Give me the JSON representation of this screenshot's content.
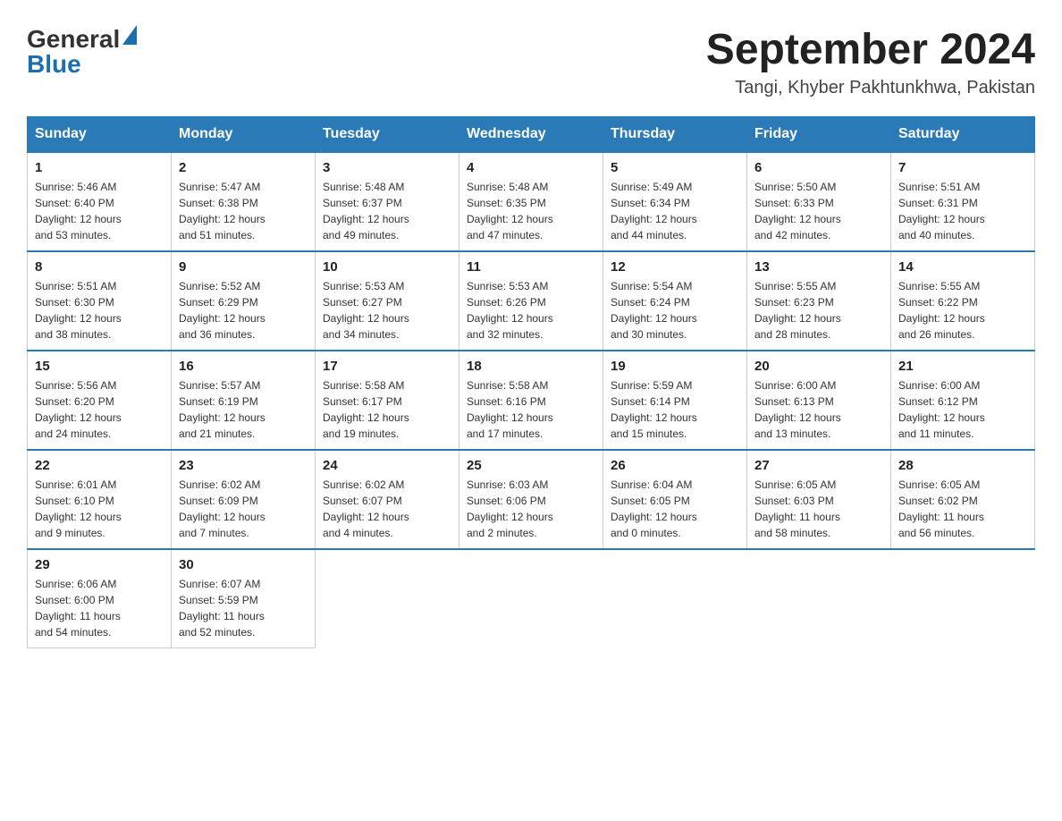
{
  "header": {
    "logo_general": "General",
    "logo_blue": "Blue",
    "month_year": "September 2024",
    "location": "Tangi, Khyber Pakhtunkhwa, Pakistan"
  },
  "weekdays": [
    "Sunday",
    "Monday",
    "Tuesday",
    "Wednesday",
    "Thursday",
    "Friday",
    "Saturday"
  ],
  "weeks": [
    [
      {
        "day": "1",
        "sunrise": "5:46 AM",
        "sunset": "6:40 PM",
        "daylight": "12 hours and 53 minutes."
      },
      {
        "day": "2",
        "sunrise": "5:47 AM",
        "sunset": "6:38 PM",
        "daylight": "12 hours and 51 minutes."
      },
      {
        "day": "3",
        "sunrise": "5:48 AM",
        "sunset": "6:37 PM",
        "daylight": "12 hours and 49 minutes."
      },
      {
        "day": "4",
        "sunrise": "5:48 AM",
        "sunset": "6:35 PM",
        "daylight": "12 hours and 47 minutes."
      },
      {
        "day": "5",
        "sunrise": "5:49 AM",
        "sunset": "6:34 PM",
        "daylight": "12 hours and 44 minutes."
      },
      {
        "day": "6",
        "sunrise": "5:50 AM",
        "sunset": "6:33 PM",
        "daylight": "12 hours and 42 minutes."
      },
      {
        "day": "7",
        "sunrise": "5:51 AM",
        "sunset": "6:31 PM",
        "daylight": "12 hours and 40 minutes."
      }
    ],
    [
      {
        "day": "8",
        "sunrise": "5:51 AM",
        "sunset": "6:30 PM",
        "daylight": "12 hours and 38 minutes."
      },
      {
        "day": "9",
        "sunrise": "5:52 AM",
        "sunset": "6:29 PM",
        "daylight": "12 hours and 36 minutes."
      },
      {
        "day": "10",
        "sunrise": "5:53 AM",
        "sunset": "6:27 PM",
        "daylight": "12 hours and 34 minutes."
      },
      {
        "day": "11",
        "sunrise": "5:53 AM",
        "sunset": "6:26 PM",
        "daylight": "12 hours and 32 minutes."
      },
      {
        "day": "12",
        "sunrise": "5:54 AM",
        "sunset": "6:24 PM",
        "daylight": "12 hours and 30 minutes."
      },
      {
        "day": "13",
        "sunrise": "5:55 AM",
        "sunset": "6:23 PM",
        "daylight": "12 hours and 28 minutes."
      },
      {
        "day": "14",
        "sunrise": "5:55 AM",
        "sunset": "6:22 PM",
        "daylight": "12 hours and 26 minutes."
      }
    ],
    [
      {
        "day": "15",
        "sunrise": "5:56 AM",
        "sunset": "6:20 PM",
        "daylight": "12 hours and 24 minutes."
      },
      {
        "day": "16",
        "sunrise": "5:57 AM",
        "sunset": "6:19 PM",
        "daylight": "12 hours and 21 minutes."
      },
      {
        "day": "17",
        "sunrise": "5:58 AM",
        "sunset": "6:17 PM",
        "daylight": "12 hours and 19 minutes."
      },
      {
        "day": "18",
        "sunrise": "5:58 AM",
        "sunset": "6:16 PM",
        "daylight": "12 hours and 17 minutes."
      },
      {
        "day": "19",
        "sunrise": "5:59 AM",
        "sunset": "6:14 PM",
        "daylight": "12 hours and 15 minutes."
      },
      {
        "day": "20",
        "sunrise": "6:00 AM",
        "sunset": "6:13 PM",
        "daylight": "12 hours and 13 minutes."
      },
      {
        "day": "21",
        "sunrise": "6:00 AM",
        "sunset": "6:12 PM",
        "daylight": "12 hours and 11 minutes."
      }
    ],
    [
      {
        "day": "22",
        "sunrise": "6:01 AM",
        "sunset": "6:10 PM",
        "daylight": "12 hours and 9 minutes."
      },
      {
        "day": "23",
        "sunrise": "6:02 AM",
        "sunset": "6:09 PM",
        "daylight": "12 hours and 7 minutes."
      },
      {
        "day": "24",
        "sunrise": "6:02 AM",
        "sunset": "6:07 PM",
        "daylight": "12 hours and 4 minutes."
      },
      {
        "day": "25",
        "sunrise": "6:03 AM",
        "sunset": "6:06 PM",
        "daylight": "12 hours and 2 minutes."
      },
      {
        "day": "26",
        "sunrise": "6:04 AM",
        "sunset": "6:05 PM",
        "daylight": "12 hours and 0 minutes."
      },
      {
        "day": "27",
        "sunrise": "6:05 AM",
        "sunset": "6:03 PM",
        "daylight": "11 hours and 58 minutes."
      },
      {
        "day": "28",
        "sunrise": "6:05 AM",
        "sunset": "6:02 PM",
        "daylight": "11 hours and 56 minutes."
      }
    ],
    [
      {
        "day": "29",
        "sunrise": "6:06 AM",
        "sunset": "6:00 PM",
        "daylight": "11 hours and 54 minutes."
      },
      {
        "day": "30",
        "sunrise": "6:07 AM",
        "sunset": "5:59 PM",
        "daylight": "11 hours and 52 minutes."
      },
      null,
      null,
      null,
      null,
      null
    ]
  ]
}
